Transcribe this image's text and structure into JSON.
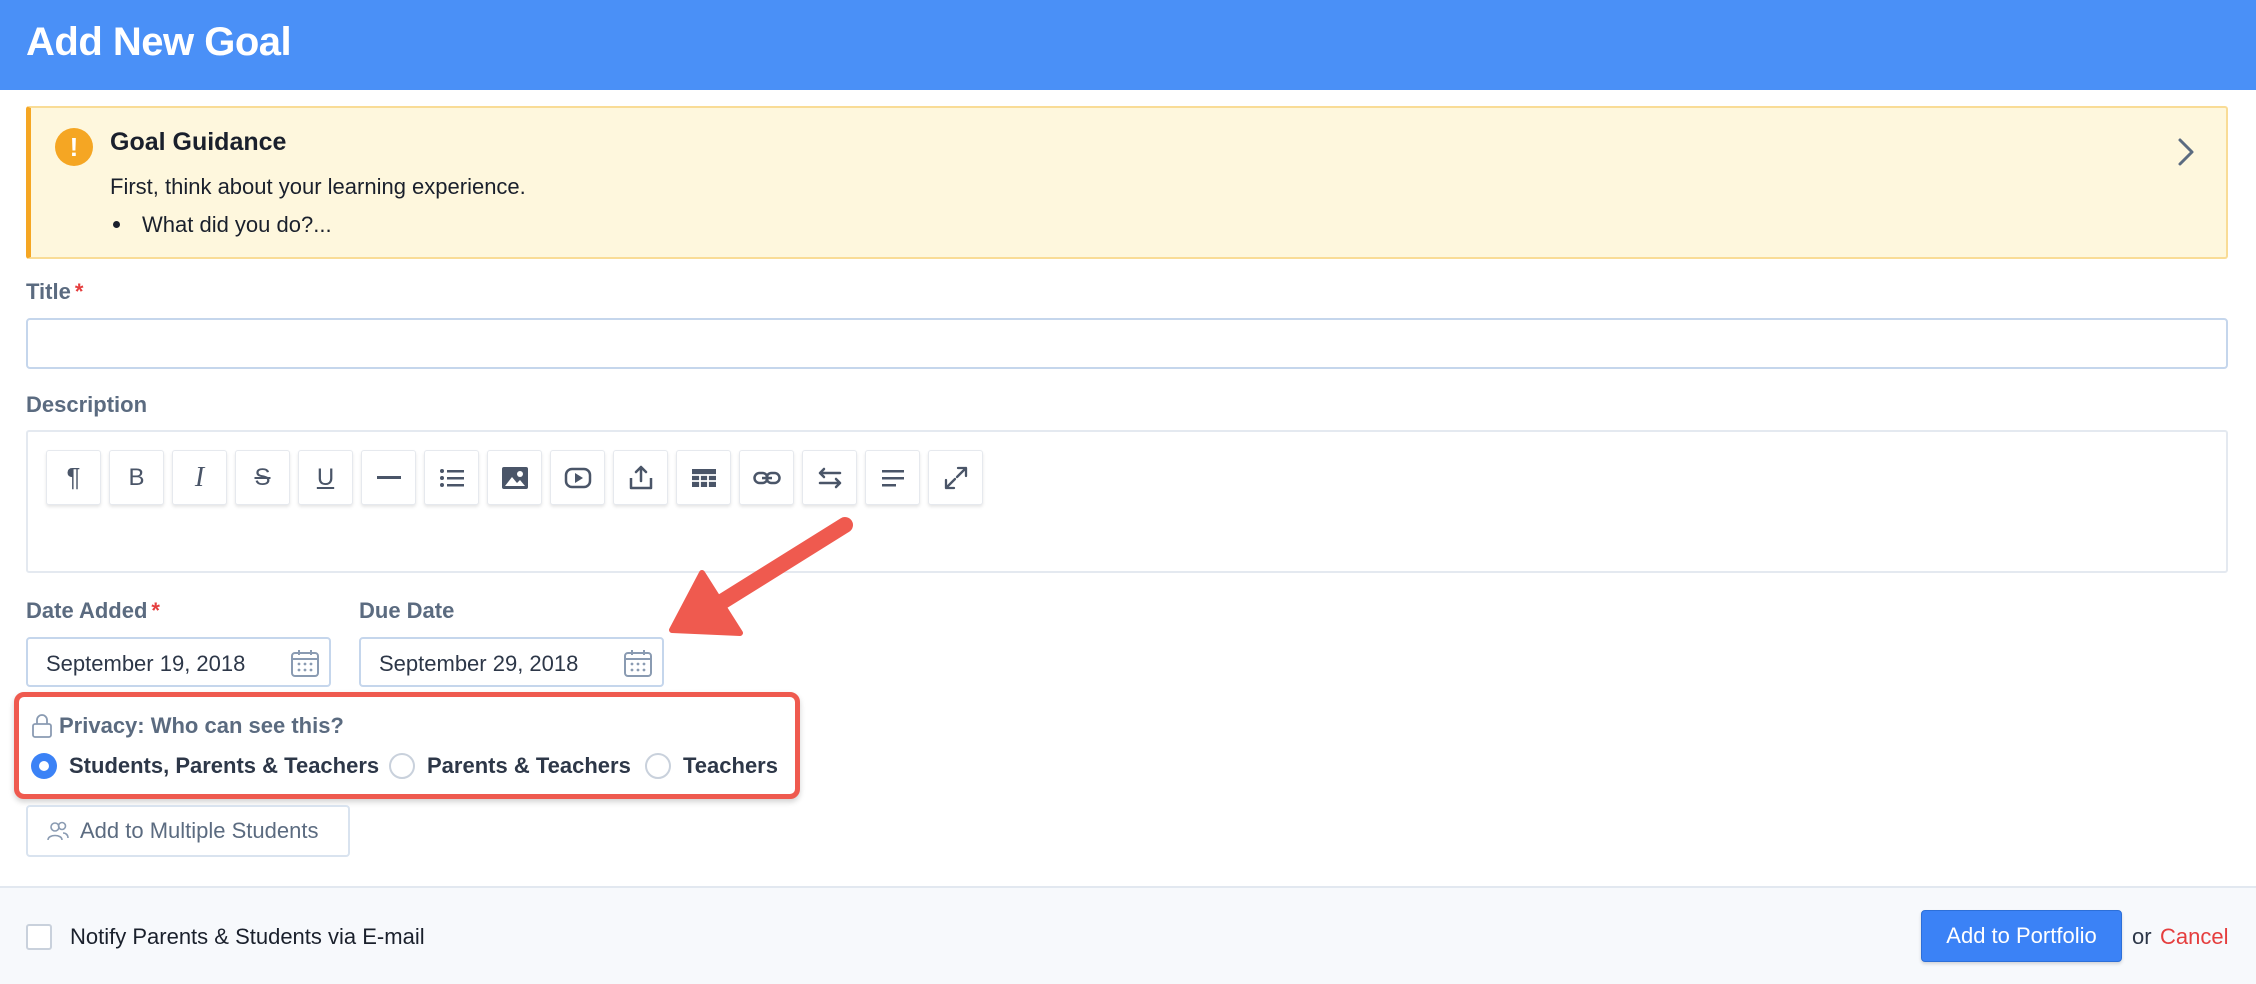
{
  "header": {
    "title": "Add New Goal"
  },
  "guidance": {
    "icon": "exclamation-icon",
    "title": "Goal Guidance",
    "text": "First, think about your learning experience.",
    "bullet": "What did you do?..."
  },
  "form": {
    "title_label": "Title",
    "title_value": "",
    "description_label": "Description",
    "toolbar_icons": [
      "paragraph-icon",
      "bold-icon",
      "italic-icon",
      "strikethrough-icon",
      "underline-icon",
      "horizontal-rule-icon",
      "list-icon",
      "image-icon",
      "video-icon",
      "upload-icon",
      "table-icon",
      "link-icon",
      "swap-icon",
      "align-icon",
      "fullscreen-icon"
    ],
    "toolbar_glyphs": {
      "paragraph": "¶",
      "bold": "B",
      "italic": "I",
      "strike": "S",
      "underline": "U"
    },
    "date_added_label": "Date Added",
    "date_added_value": "September 19, 2018",
    "due_date_label": "Due Date",
    "due_date_value": "September 29, 2018",
    "required_marker": "*"
  },
  "privacy": {
    "label": "Privacy: Who can see this?",
    "options": [
      {
        "label": "Students, Parents & Teachers",
        "checked": true
      },
      {
        "label": "Parents & Teachers",
        "checked": false
      },
      {
        "label": "Teachers",
        "checked": false
      }
    ]
  },
  "multi_students": {
    "label": "Add to Multiple Students"
  },
  "footer": {
    "notify_label": "Notify Parents & Students via E-mail",
    "notify_checked": false,
    "submit_label": "Add to Portfolio",
    "or_text": "or",
    "cancel_label": "Cancel"
  },
  "colors": {
    "header_bg": "#4a90f7",
    "guidance_bg": "#fef7dd",
    "guidance_accent": "#f5a623",
    "primary": "#3b82f6",
    "danger": "#e53e3e",
    "annotation": "#ef5a4f"
  }
}
